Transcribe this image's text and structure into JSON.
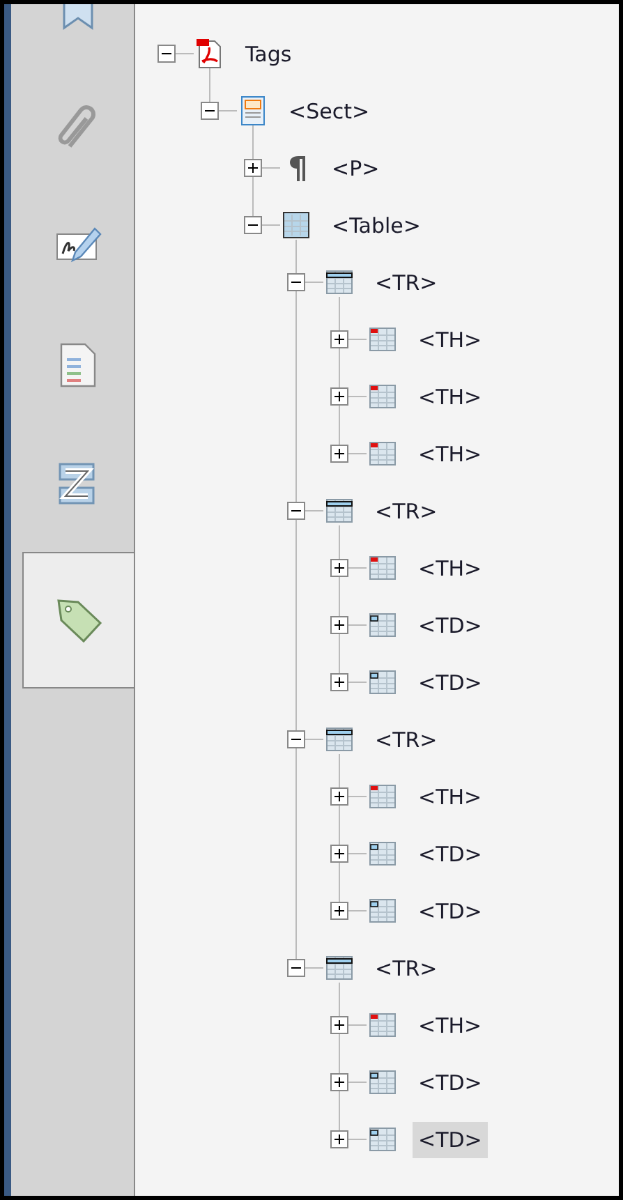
{
  "sidebar": {
    "tabs": [
      {
        "kind": "bookmark",
        "selected": false
      },
      {
        "kind": "paperclip",
        "selected": false
      },
      {
        "kind": "signature",
        "selected": false
      },
      {
        "kind": "page",
        "selected": false
      },
      {
        "kind": "order",
        "selected": false
      },
      {
        "kind": "tag",
        "selected": true
      }
    ]
  },
  "tree": [
    {
      "label": "Tags",
      "kind": "document",
      "expanded": true,
      "selected": false,
      "children": [
        {
          "label": "<Sect>",
          "kind": "section",
          "expanded": true,
          "selected": false,
          "children": [
            {
              "label": "<P>",
              "kind": "paragraph",
              "expanded": false,
              "selected": false
            },
            {
              "label": "<Table>",
              "kind": "table",
              "expanded": true,
              "selected": false,
              "children": [
                {
                  "label": "<TR>",
                  "kind": "row",
                  "expanded": true,
                  "selected": false,
                  "children": [
                    {
                      "label": "<TH>",
                      "kind": "header-cell",
                      "expanded": false,
                      "selected": false
                    },
                    {
                      "label": "<TH>",
                      "kind": "header-cell",
                      "expanded": false,
                      "selected": false
                    },
                    {
                      "label": "<TH>",
                      "kind": "header-cell",
                      "expanded": false,
                      "selected": false
                    }
                  ]
                },
                {
                  "label": "<TR>",
                  "kind": "row",
                  "expanded": true,
                  "selected": false,
                  "children": [
                    {
                      "label": "<TH>",
                      "kind": "header-cell",
                      "expanded": false,
                      "selected": false
                    },
                    {
                      "label": "<TD>",
                      "kind": "data-cell",
                      "expanded": false,
                      "selected": false
                    },
                    {
                      "label": "<TD>",
                      "kind": "data-cell",
                      "expanded": false,
                      "selected": false
                    }
                  ]
                },
                {
                  "label": "<TR>",
                  "kind": "row",
                  "expanded": true,
                  "selected": false,
                  "children": [
                    {
                      "label": "<TH>",
                      "kind": "header-cell",
                      "expanded": false,
                      "selected": false
                    },
                    {
                      "label": "<TD>",
                      "kind": "data-cell",
                      "expanded": false,
                      "selected": false
                    },
                    {
                      "label": "<TD>",
                      "kind": "data-cell",
                      "expanded": false,
                      "selected": false
                    }
                  ]
                },
                {
                  "label": "<TR>",
                  "kind": "row",
                  "expanded": true,
                  "selected": false,
                  "children": [
                    {
                      "label": "<TH>",
                      "kind": "header-cell",
                      "expanded": false,
                      "selected": false
                    },
                    {
                      "label": "<TD>",
                      "kind": "data-cell",
                      "expanded": false,
                      "selected": false
                    },
                    {
                      "label": "<TD>",
                      "kind": "data-cell",
                      "expanded": false,
                      "selected": true
                    }
                  ]
                }
              ]
            }
          ]
        }
      ]
    }
  ]
}
